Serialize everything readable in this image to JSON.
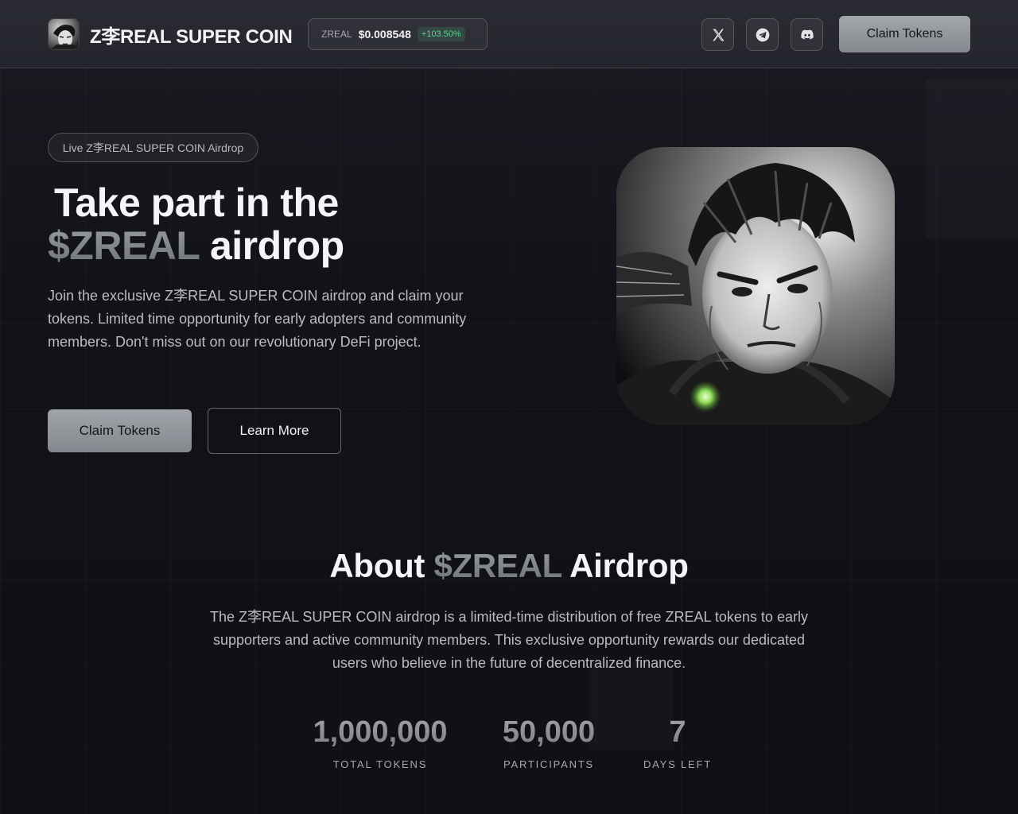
{
  "brand": {
    "name": "Z李REAL SUPER COIN",
    "logo_icon": "avatar-portrait-icon"
  },
  "ticker": {
    "symbol": "ZREAL",
    "price": "$0.008548",
    "change": "+103.50%"
  },
  "social": [
    {
      "name": "x-twitter-icon"
    },
    {
      "name": "telegram-icon"
    },
    {
      "name": "discord-icon"
    }
  ],
  "header": {
    "cta_label": "Claim Tokens"
  },
  "hero": {
    "pill": "Live Z李REAL SUPER COIN Airdrop",
    "title_line1": "Take part in the",
    "title_accent": "$ZREAL",
    "title_rest": " airdrop",
    "description": "Join the exclusive Z李REAL SUPER COIN airdrop and claim your tokens. Limited time opportunity for early adopters and community members. Don't miss out on our revolutionary DeFi project.",
    "primary_label": "Claim Tokens",
    "secondary_label": "Learn More"
  },
  "about": {
    "title_pre": "About ",
    "title_accent": "$ZREAL",
    "title_post": " Airdrop",
    "description": "The Z李REAL SUPER COIN airdrop is a limited-time distribution of free ZREAL tokens to early supporters and active community members. This exclusive opportunity rewards our dedicated users who believe in the future of decentralized finance."
  },
  "stats": [
    {
      "value": "1,000,000",
      "label": "TOTAL TOKENS"
    },
    {
      "value": "50,000",
      "label": "PARTICIPANTS"
    },
    {
      "value": "7",
      "label": "DAYS LEFT"
    }
  ],
  "colors": {
    "background": "#111217",
    "header_bg": "#26272f",
    "accent_gray": "#8f9197",
    "positive": "#58d68d"
  }
}
